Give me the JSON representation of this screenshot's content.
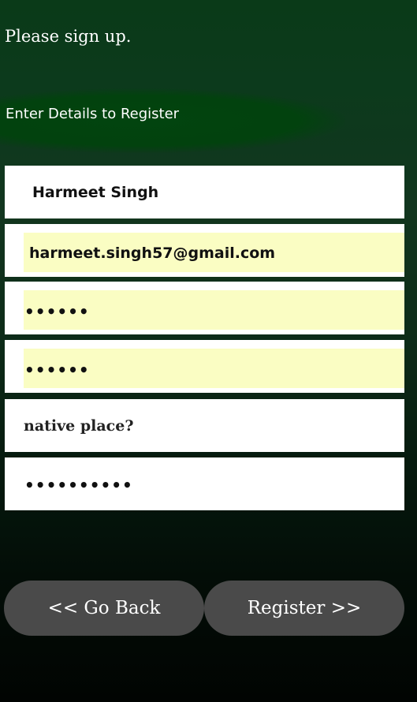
{
  "header": {
    "title": "Please sign up.",
    "subtitle": "Enter Details to Register"
  },
  "form": {
    "name": "Harmeet Singh",
    "email": "harmeet.singh57@gmail.com",
    "password": "••••••",
    "confirm_password": "••••••",
    "security_question_placeholder": "native place?",
    "security_answer": "••••••••••"
  },
  "actions": {
    "back_label": "<< Go Back",
    "register_label": "Register >>"
  },
  "colors": {
    "background_top": "#0a3a18",
    "background_bottom": "#010402",
    "autofill": "#fafdc3",
    "button": "#4a4a4a"
  }
}
